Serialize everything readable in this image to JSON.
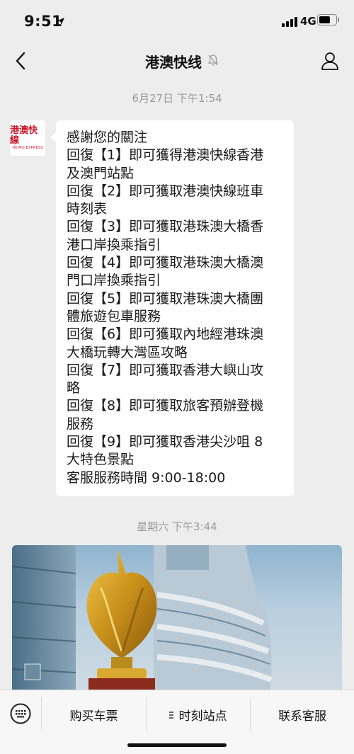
{
  "status_bar": {
    "time": "9:51",
    "network": "4G"
  },
  "nav": {
    "title": "港澳快线"
  },
  "chat": {
    "timestamp_1": "6月27日 下午1:54",
    "avatar_logo_text": "港澳快線",
    "avatar_logo_sub": "HK-MO EXPRESS",
    "message_lines": [
      "感謝您的關注",
      "回復【1】即可獲得港澳快線香港",
      "及澳門站點",
      "回復【2】即可獲取港澳快線班車",
      "時刻表",
      "回復【3】即可獲取港珠澳大橋香",
      "港口岸換乘指引",
      "回復【4】即可獲取港珠澳大橋澳",
      "門口岸換乘指引",
      "回復【5】即可獲取港珠澳大橋團",
      "體旅遊包車服務",
      "回復【6】即可獲取內地經港珠澳",
      "大橋玩轉大灣區攻略",
      "回復【7】即可獲取香港大嶼山攻",
      "略",
      "回復【8】即可獲取旅客預辦登機",
      "服務",
      "回復【9】即可獲取香港尖沙咀 8",
      "大特色景點",
      "客服服務時間 9:00-18:00"
    ],
    "timestamp_2": "星期六 下午3:44"
  },
  "menu": {
    "item_1": "购买车票",
    "item_2": "时刻站点",
    "item_3": "联系客服"
  },
  "colors": {
    "background": "#ededed",
    "bubble": "#ffffff",
    "brand_red": "#d0152a",
    "timestamp": "#9a9a9a"
  },
  "icons": {
    "back": "chevron-left-icon",
    "mute": "bell-muted-icon",
    "profile": "person-icon",
    "keyboard": "keyboard-icon",
    "submenu": "menu-lines-icon"
  }
}
